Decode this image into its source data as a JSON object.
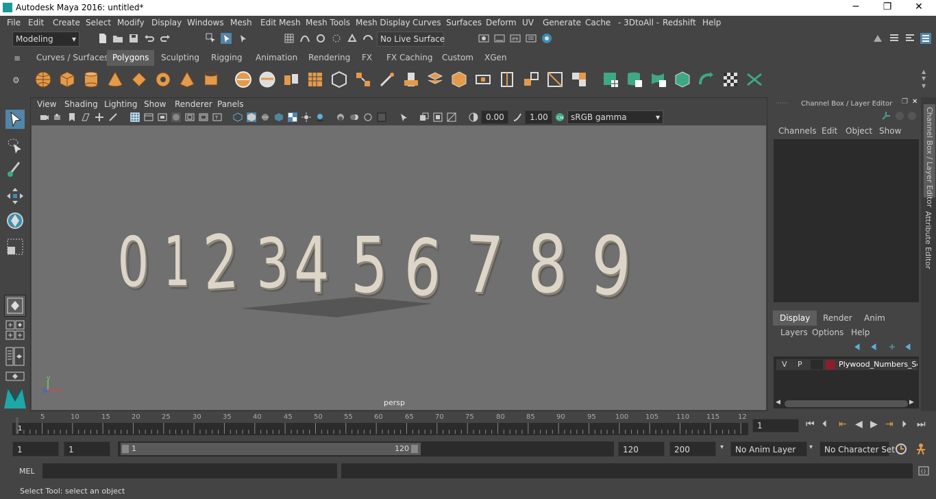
{
  "window": {
    "title": "Autodesk Maya 2016: untitled*",
    "minimize": "─",
    "restore": "❐",
    "close": "✕"
  },
  "menubar": [
    "File",
    "Edit",
    "Create",
    "Select",
    "Modify",
    "Display",
    "Windows",
    "Mesh",
    "Edit Mesh",
    "Mesh Tools",
    "Mesh Display",
    "Curves",
    "Surfaces",
    "Deform",
    "UV",
    "Generate",
    "Cache",
    "- 3DtoAll -",
    "Redshift",
    "Help"
  ],
  "statusline": {
    "menuset": "Modeling",
    "live_surface": "No Live Surface"
  },
  "shelf_tabs": [
    "Curves / Surfaces",
    "Polygons",
    "Sculpting",
    "Rigging",
    "Animation",
    "Rendering",
    "FX",
    "FX Caching",
    "Custom",
    "XGen"
  ],
  "active_shelf_tab": "Polygons",
  "panel_menu": [
    "View",
    "Shading",
    "Lighting",
    "Show",
    "Renderer",
    "Panels"
  ],
  "panel_toolbar": {
    "exposure": "0.00",
    "gamma": "1.00",
    "color_space": "sRGB gamma"
  },
  "viewport": {
    "camera_label": "persp",
    "digits": [
      "0",
      "1",
      "2",
      "3",
      "4",
      "5",
      "6",
      "7",
      "8",
      "9"
    ],
    "axis_labels": [
      "y",
      "z",
      "x"
    ]
  },
  "channel_box": {
    "title": "Channel Box / Layer Editor",
    "menu": [
      "Channels",
      "Edit",
      "Object",
      "Show"
    ],
    "layer_tabs": [
      "Display",
      "Render",
      "Anim"
    ],
    "layer_menu": [
      "Layers",
      "Options",
      "Help"
    ],
    "layer": {
      "visible": "V",
      "playback": "P",
      "name": "Plywood_Numbers_Set"
    }
  },
  "side_tabs": [
    "Channel Box / Layer Editor",
    "Attribute Editor"
  ],
  "time_slider": {
    "ticks": [
      "5",
      "10",
      "15",
      "20",
      "25",
      "30",
      "35",
      "40",
      "45",
      "50",
      "55",
      "60",
      "65",
      "70",
      "75",
      "80",
      "85",
      "90",
      "95",
      "100",
      "105",
      "110",
      "115",
      "12"
    ],
    "start_tick": "1",
    "current_frame": "1"
  },
  "range": {
    "start": "1",
    "playback_start": "1",
    "slider_start": "1",
    "slider_end": "120",
    "playback_end": "120",
    "end": "200",
    "anim_layer": "No Anim Layer",
    "character_set": "No Character Set"
  },
  "mel": {
    "label": "MEL"
  },
  "help_line": "Select Tool: select an object",
  "colors": {
    "layer_swatch": "#8a1f2a",
    "accent": "#5285a6",
    "shelf_orange": "#e39a4a",
    "shelf_green": "#3ea883"
  }
}
